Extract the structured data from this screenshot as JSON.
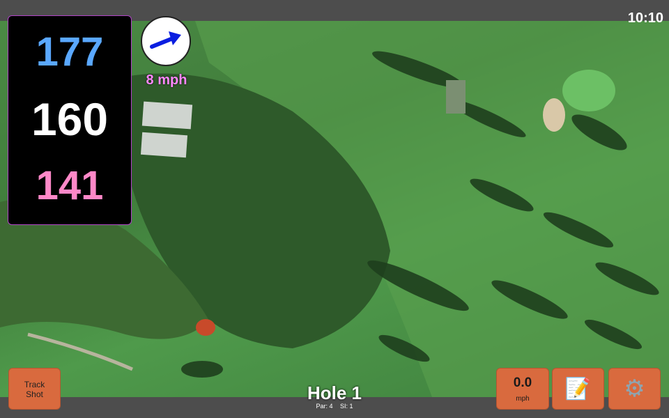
{
  "status": {
    "time": "10:10"
  },
  "distances": {
    "back": "177",
    "middle": "160",
    "front": "141"
  },
  "wind": {
    "speed": "8 mph",
    "icon": "arrow-right-icon",
    "arrow_color": "#0a1ee0"
  },
  "hole": {
    "title": "Hole 1",
    "par": "Par: 4",
    "si": "SI: 1"
  },
  "buttons": {
    "track_shot": {
      "line1": "Track",
      "line2": "Shot"
    },
    "speed": {
      "value": "0.0",
      "unit": "mph"
    },
    "notes": {
      "icon": "notepad-icon"
    },
    "settings": {
      "icon": "gear-icon"
    }
  },
  "colors": {
    "button": "#d96a3e",
    "back": "#5aa8ff",
    "middle": "#ffffff",
    "front": "#ff88c8",
    "panel_border": "#b044c8",
    "wind_text": "#ff88ff"
  }
}
